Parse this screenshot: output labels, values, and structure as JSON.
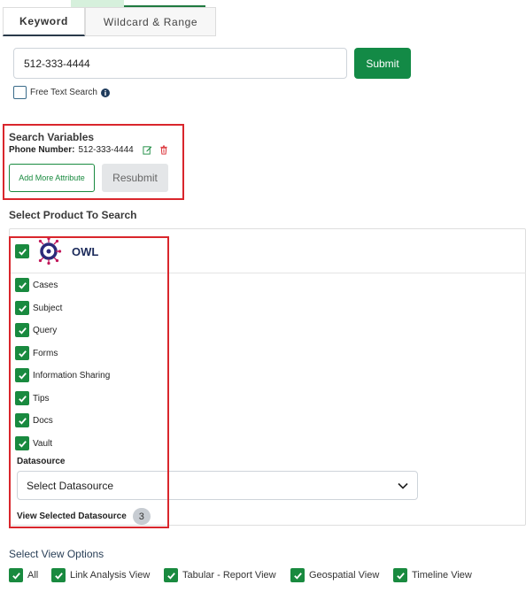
{
  "tabs": [
    {
      "label": "Keyword"
    },
    {
      "label": "Wildcard & Range"
    }
  ],
  "search": {
    "value": "512-333-4444",
    "submit_label": "Submit",
    "free_text_label": "Free Text Search"
  },
  "search_variables": {
    "title": "Search Variables",
    "field_label": "Phone Number:",
    "field_value": "512-333-4444",
    "add_more_label": "Add More Attribute",
    "resubmit_label": "Resubmit"
  },
  "product": {
    "section_title": "Select Product To Search",
    "name": "OWL",
    "items": [
      "Cases",
      "Subject",
      "Query",
      "Forms",
      "Information Sharing",
      "Tips",
      "Docs",
      "Vault"
    ],
    "datasource_label": "Datasource",
    "datasource_placeholder": "Select Datasource",
    "view_selected_label": "View Selected Datasource",
    "selected_count": "3"
  },
  "view_options": {
    "title": "Select View Options",
    "options": [
      "All",
      "Link Analysis View",
      "Tabular - Report View",
      "Geospatial View",
      "Timeline View"
    ]
  },
  "colors": {
    "primary_green": "#198a3f",
    "highlight_red": "#d9262c",
    "logo_purple": "#5b2a86"
  }
}
